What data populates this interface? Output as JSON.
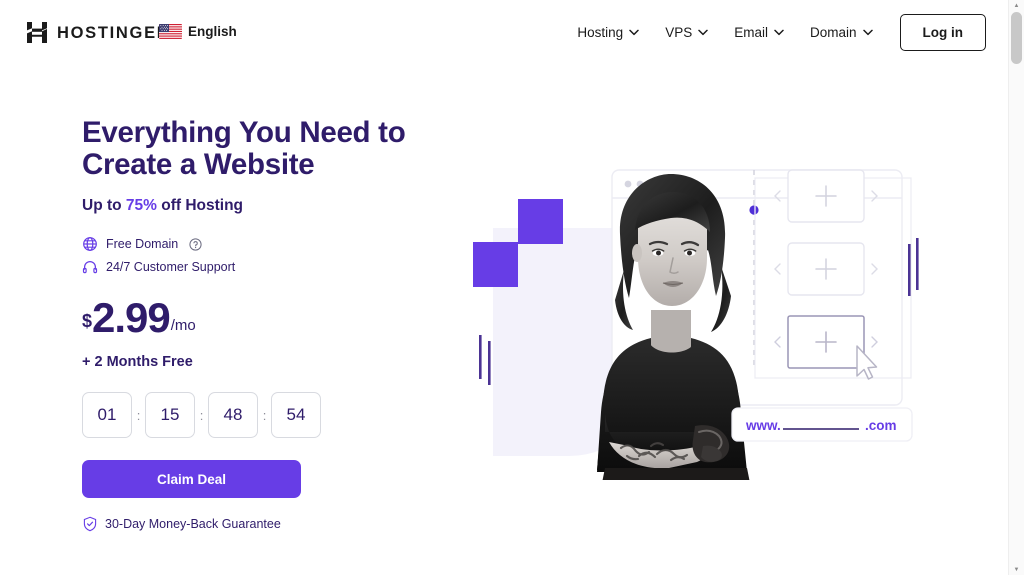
{
  "header": {
    "brand": {
      "logo_icon": "hostinger-h-logo-icon",
      "name": "HOSTINGER"
    },
    "language": {
      "flag_icon": "us-flag-icon",
      "label": "English"
    },
    "nav_items": [
      {
        "label": "Hosting",
        "icon": "chevron-down-icon"
      },
      {
        "label": "VPS",
        "icon": "chevron-down-icon"
      },
      {
        "label": "Email",
        "icon": "chevron-down-icon"
      },
      {
        "label": "Domain",
        "icon": "chevron-down-icon"
      }
    ],
    "login_label": "Log in"
  },
  "hero": {
    "headline_line1": "Everything You Need to",
    "headline_line2": "Create a Website",
    "sub_prefix": "Up to ",
    "sub_highlight": "75%",
    "sub_suffix": " off Hosting",
    "features": [
      {
        "icon": "globe-icon",
        "label": "Free Domain",
        "has_info": true,
        "info_icon": "question-circle-icon"
      },
      {
        "icon": "headset-icon",
        "label": "24/7 Customer Support",
        "has_info": false
      }
    ],
    "price": {
      "currency": "$",
      "amount": "2.99",
      "period": "/mo"
    },
    "months_free": "+ 2 Months Free",
    "timer": {
      "values": [
        "01",
        "15",
        "48",
        "54"
      ],
      "separator": ":"
    },
    "cta_label": "Claim Deal",
    "guarantee": {
      "icon": "shield-check-icon",
      "label": "30-Day Money-Back Guarantee"
    }
  },
  "illustration": {
    "domain_bar": {
      "prefix": "www.",
      "suffix": ".com"
    },
    "card_plus_label": "+",
    "colors": {
      "accent_purple": "#673de6",
      "deep_purple": "#2f1c6a",
      "pale_lavender": "#f3f2fb"
    }
  },
  "scrollbar": {
    "up_arrow": "▲",
    "down_arrow": "▼"
  }
}
